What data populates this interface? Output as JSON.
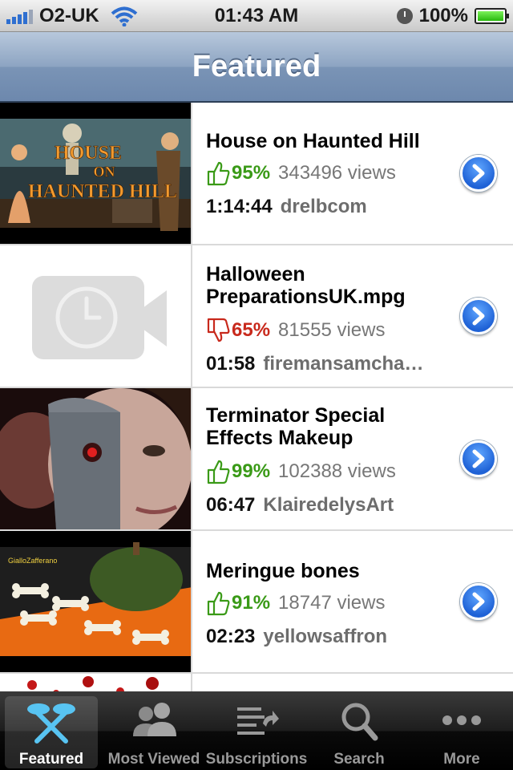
{
  "status_bar": {
    "carrier": "O2-UK",
    "time": "01:43 AM",
    "battery": "100%"
  },
  "nav": {
    "title": "Featured"
  },
  "videos": [
    {
      "title": "House on Haunted Hill",
      "rating": "95%",
      "rating_type": "up",
      "views": "343496 views",
      "duration": "1:14:44",
      "author": "drelbcom",
      "thumbnail": "poster-house-on-haunted-hill",
      "thumb_text": "HOUSE ON HAUNTED HILL"
    },
    {
      "title": "Halloween PreparationsUK.mpg",
      "rating": "65%",
      "rating_type": "down",
      "views": "81555 views",
      "duration": "01:58",
      "author": "firemansamcha…",
      "thumbnail": "video-camera-placeholder-icon"
    },
    {
      "title": "Terminator Special Effects Makeup",
      "rating": "99%",
      "rating_type": "up",
      "views": "102388 views",
      "duration": "06:47",
      "author": "KlairedelysArt",
      "thumbnail": "cyborg-face-makeup"
    },
    {
      "title": "Meringue bones",
      "rating": "91%",
      "rating_type": "up",
      "views": "18747 views",
      "duration": "02:23",
      "author": "yellowsaffron",
      "thumbnail": "meringue-bones-with-pumpkin",
      "thumb_text": "GialloZafferano"
    }
  ],
  "tabs": [
    {
      "label": "Featured",
      "icon": "featured-x-icon",
      "active": true
    },
    {
      "label": "Most Viewed",
      "icon": "people-icon",
      "active": false
    },
    {
      "label": "Subscriptions",
      "icon": "subscriptions-icon",
      "active": false
    },
    {
      "label": "Search",
      "icon": "search-icon",
      "active": false
    },
    {
      "label": "More",
      "icon": "more-dots-icon",
      "active": false
    }
  ],
  "colors": {
    "rating_up": "#3a9a17",
    "rating_down": "#c8291c",
    "nav_bar": "#8da4c2",
    "disclosure": "#1f62d6"
  }
}
